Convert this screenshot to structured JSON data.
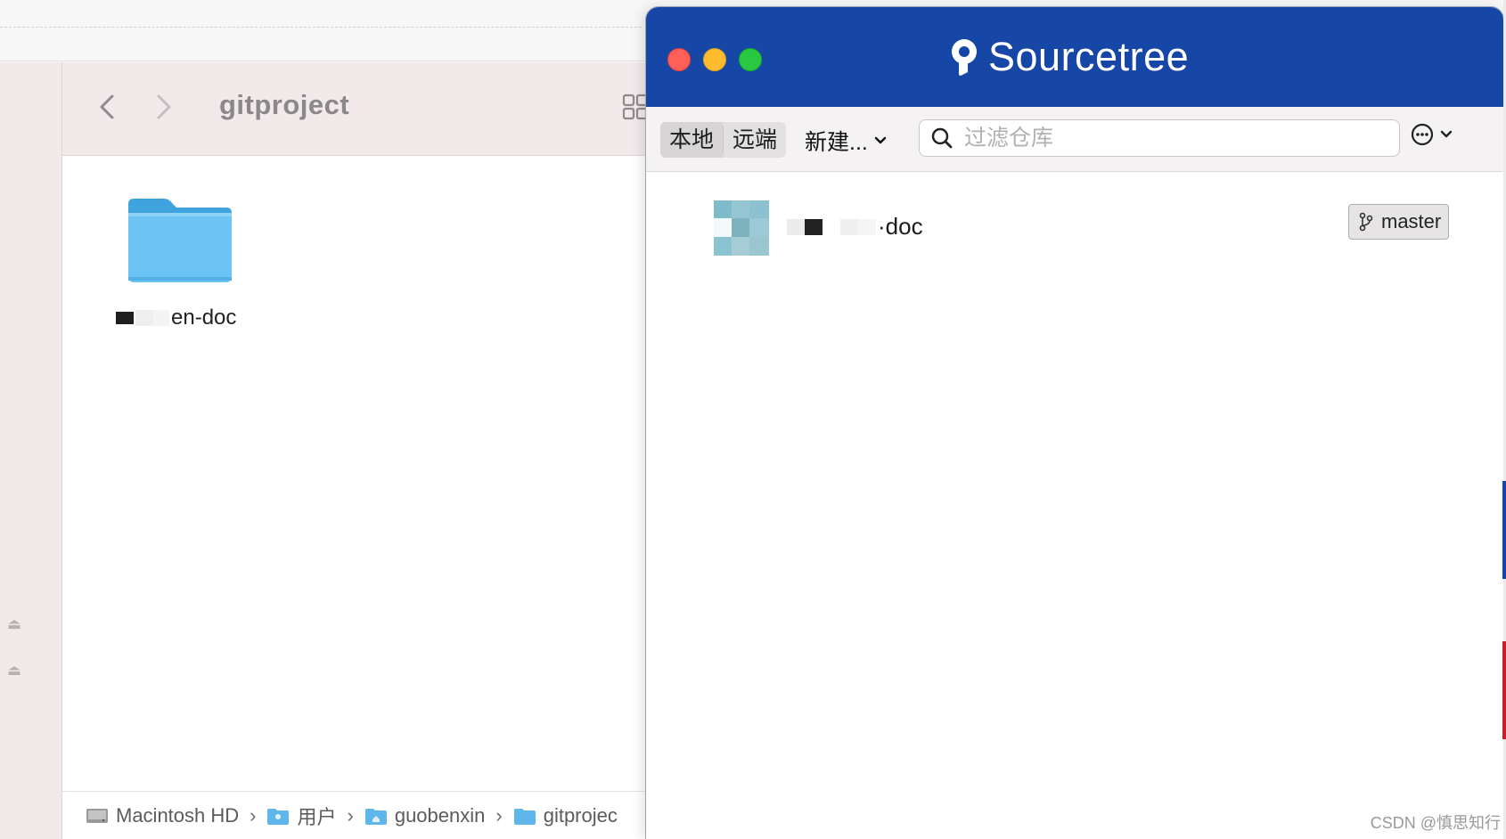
{
  "finder": {
    "title": "gitproject",
    "folder_label_suffix": "en-doc",
    "pathbar": [
      {
        "label": "Macintosh HD",
        "icon": "hard-drive-icon"
      },
      {
        "label": "用户",
        "icon": "users-folder-icon"
      },
      {
        "label": "guobenxin",
        "icon": "home-folder-icon"
      },
      {
        "label": "gitprojec",
        "icon": "folder-icon"
      }
    ]
  },
  "sourcetree": {
    "brand": "Sourcetree",
    "tabs": [
      {
        "label": "本地",
        "active": true
      },
      {
        "label": "远端",
        "active": false
      }
    ],
    "new_label": "新建...",
    "search": {
      "placeholder": "过滤仓库",
      "value": ""
    },
    "repos": [
      {
        "name_suffix": "·doc",
        "branch": "master"
      }
    ],
    "colors": {
      "header": "#1747a6",
      "close": "#ff5f57",
      "minimize": "#febc2e",
      "zoom": "#28c840"
    }
  },
  "watermark": "CSDN @慎思知行"
}
